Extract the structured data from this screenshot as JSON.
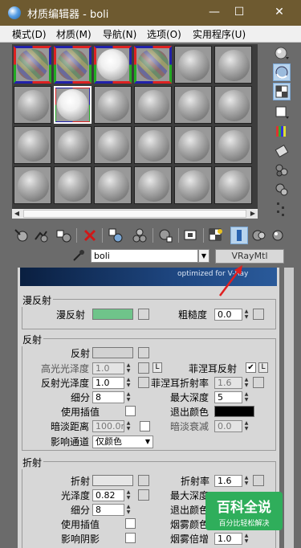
{
  "titlebar": {
    "title": "材质编辑器 - boli",
    "minimize": "—",
    "maximize": "☐",
    "close": "✕"
  },
  "menu": {
    "items": [
      "模式(D)",
      "材质(M)",
      "导航(N)",
      "选项(O)",
      "实用程序(U)"
    ]
  },
  "material": {
    "name": "boli",
    "type_button": "VRayMtl"
  },
  "banner": {
    "text": "optimized for V-Ray"
  },
  "diffuse_group": {
    "title": "漫反射",
    "diffuse_label": "漫反射",
    "diffuse_color": "#6fc48a",
    "roughness_label": "粗糙度",
    "roughness_value": "0.0"
  },
  "reflection_group": {
    "title": "反射",
    "reflect_label": "反射",
    "reflect_color": "#d2d2d2",
    "hilight_gloss_label": "高光光泽度",
    "hilight_gloss_value": "1.0",
    "l_label": "L",
    "fresnel_label": "菲涅耳反射",
    "fresnel_checked": "✔",
    "refl_gloss_label": "反射光泽度",
    "refl_gloss_value": "1.0",
    "fresnel_ior_label": "菲涅耳折射率",
    "fresnel_ior_value": "1.6",
    "subdivs_label": "细分",
    "subdivs_value": "8",
    "max_depth_label": "最大深度",
    "max_depth_value": "5",
    "use_interp_label": "使用插值",
    "exit_color_label": "退出颜色",
    "exit_color": "#000000",
    "dim_distance_label": "暗淡距离",
    "dim_distance_value": "100.0m",
    "dim_falloff_label": "暗淡衰减",
    "dim_falloff_value": "0.0",
    "affect_channels_label": "影响通道",
    "affect_channels_value": "仅颜色"
  },
  "refraction_group": {
    "title": "折射",
    "refract_label": "折射",
    "refract_color": "#e6e6e6",
    "ior_label": "折射率",
    "ior_value": "1.6",
    "gloss_label": "光泽度",
    "gloss_value": "0.82",
    "max_depth_label": "最大深度",
    "subdivs_label": "细分",
    "subdivs_value": "8",
    "exit_color_label": "退出颜色",
    "use_interp_label": "使用插值",
    "fog_color_label": "烟雾颜色",
    "affect_shadows_label": "影响阴影",
    "fog_mult_label": "烟雾倍增",
    "fog_mult_value": "1.0"
  },
  "watermark": {
    "line1": "百科全说",
    "line2": "百分比轻松解决"
  },
  "colors": {
    "titlebar": "#6e5a30",
    "panel": "#d7d7d7",
    "accent": "#2fae5b",
    "annotation_arrow": "#e02020"
  }
}
